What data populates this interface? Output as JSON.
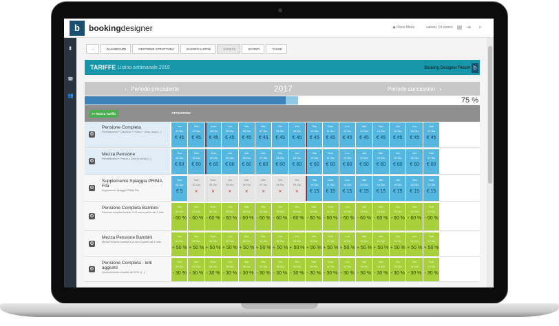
{
  "topbar": {
    "logo_mark": "b",
    "logo_text_a": "booking",
    "logo_text_b": "designer",
    "user": "Rossi Mario",
    "date": "sabato, 04 marzo"
  },
  "breadcrumb": [
    "Dashboard",
    "Gestione struttura",
    "Elenco listini",
    "Tariffe",
    "Sconti",
    "Tasse"
  ],
  "header": {
    "title": "TARIFFE",
    "subtitle": "Listino settimanale 2019",
    "brand": "Booking Designer Resort",
    "brand_logo": "b"
  },
  "period": {
    "prev": "Periodo precedente",
    "year": "2017",
    "next": "Periodo successivo",
    "percent": "75 %",
    "progress": 0.51
  },
  "table": {
    "new_button": ">> Nuova Tariffa",
    "column_header": "ATTIVAZIONI",
    "days": [
      "Ven",
      "Sab",
      "Dom",
      "Lun",
      "Mar",
      "Mer",
      "Gio",
      "Ven",
      "Sab",
      "Dom",
      "Lun",
      "Mar",
      "Mer",
      "Gio",
      "Ven",
      "Sab"
    ],
    "dates": [
      "02 Giu",
      "03 Giu",
      "04 Giu",
      "05 Giu",
      "06 Giu",
      "07 Giu",
      "08 Giu",
      "09 Giu",
      "10 Giu",
      "11 Giu",
      "12 Giu",
      "13 Giu",
      "14 Giu",
      "15 Giu",
      "16 Giu",
      "17 Giu"
    ],
    "rows": [
      {
        "name": "Pensione Completa",
        "desc": "Pernottamento + Colazione + Pranzo + Cena. Acqui [...]",
        "type": "blue",
        "values": [
          "€ 45",
          "€ 45",
          "€ 45",
          "€ 45",
          "€ 45",
          "€ 45",
          "€ 45",
          "€ 45",
          "€ 45",
          "€ 45",
          "€ 45",
          "€ 45",
          "€ 45",
          "€ 45",
          "€ 45",
          "€ 45"
        ]
      },
      {
        "name": "Mezza Pensione",
        "desc": "Pernottamento + Pranzo o Cena (a scelta) [...]",
        "type": "blue",
        "values": [
          "€ 60",
          "€ 60",
          "€ 60",
          "€ 60",
          "€ 60",
          "€ 60",
          "€ 60",
          "€ 60",
          "€ 60",
          "€ 60",
          "€ 60",
          "€ 60",
          "€ 60",
          "€ 60",
          "€ 60",
          "€ 60"
        ]
      },
      {
        "name": "Supplemento Spiaggia PRIMA Fila",
        "desc": "Supplemento Spiaggia PRIMA Fila",
        "type": "mixed",
        "values": [
          "€ 5",
          "✕",
          "✕",
          "✕",
          "✕",
          "✕",
          "✕",
          "✕",
          "€ 15",
          "€ 15",
          "€ 15",
          "€ 15",
          "€ 15",
          "€ 15",
          "€ 15",
          "€ 15"
        ]
      },
      {
        "name": "Pensione Completa Bambini",
        "desc": "Pensione completa bambini 3-10 anni a partire dal 3° letto",
        "type": "green",
        "values": [
          "- 60 %",
          "- 60 %",
          "- 60 %",
          "- 60 %",
          "- 60 %",
          "- 60 %",
          "- 60 %",
          "- 60 %",
          "- 60 %",
          "- 60 %",
          "- 60 %",
          "- 60 %",
          "- 60 %",
          "- 60 %",
          "- 60 %",
          "- 60 %"
        ]
      },
      {
        "name": "Mezza Pensione Bambini",
        "desc": "Mezza Pensione bambini 3-10 anni a partire dal 3° letto",
        "type": "green",
        "values": [
          "+ 50 %",
          "+ 50 %",
          "+ 50 %",
          "+ 50 %",
          "+ 50 %",
          "+ 50 %",
          "+ 50 %",
          "+ 50 %",
          "+ 50 %",
          "+ 50 %",
          "+ 50 %",
          "+ 50 %",
          "+ 50 %",
          "+ 50 %",
          "+ 50 %",
          "+ 50 %"
        ]
      },
      {
        "name": "Pensione Completa - letti aggiunti",
        "desc": "Quota pensione completa del 30% a [...]",
        "type": "green",
        "values": [
          "- 30 %",
          "- 30 %",
          "- 30 %",
          "- 30 %",
          "- 30 %",
          "- 30 %",
          "- 30 %",
          "- 30 %",
          "- 30 %",
          "- 30 %",
          "- 30 %",
          "- 30 %",
          "- 30 %",
          "- 30 %",
          "- 30 %",
          "- 30 %"
        ]
      }
    ]
  }
}
